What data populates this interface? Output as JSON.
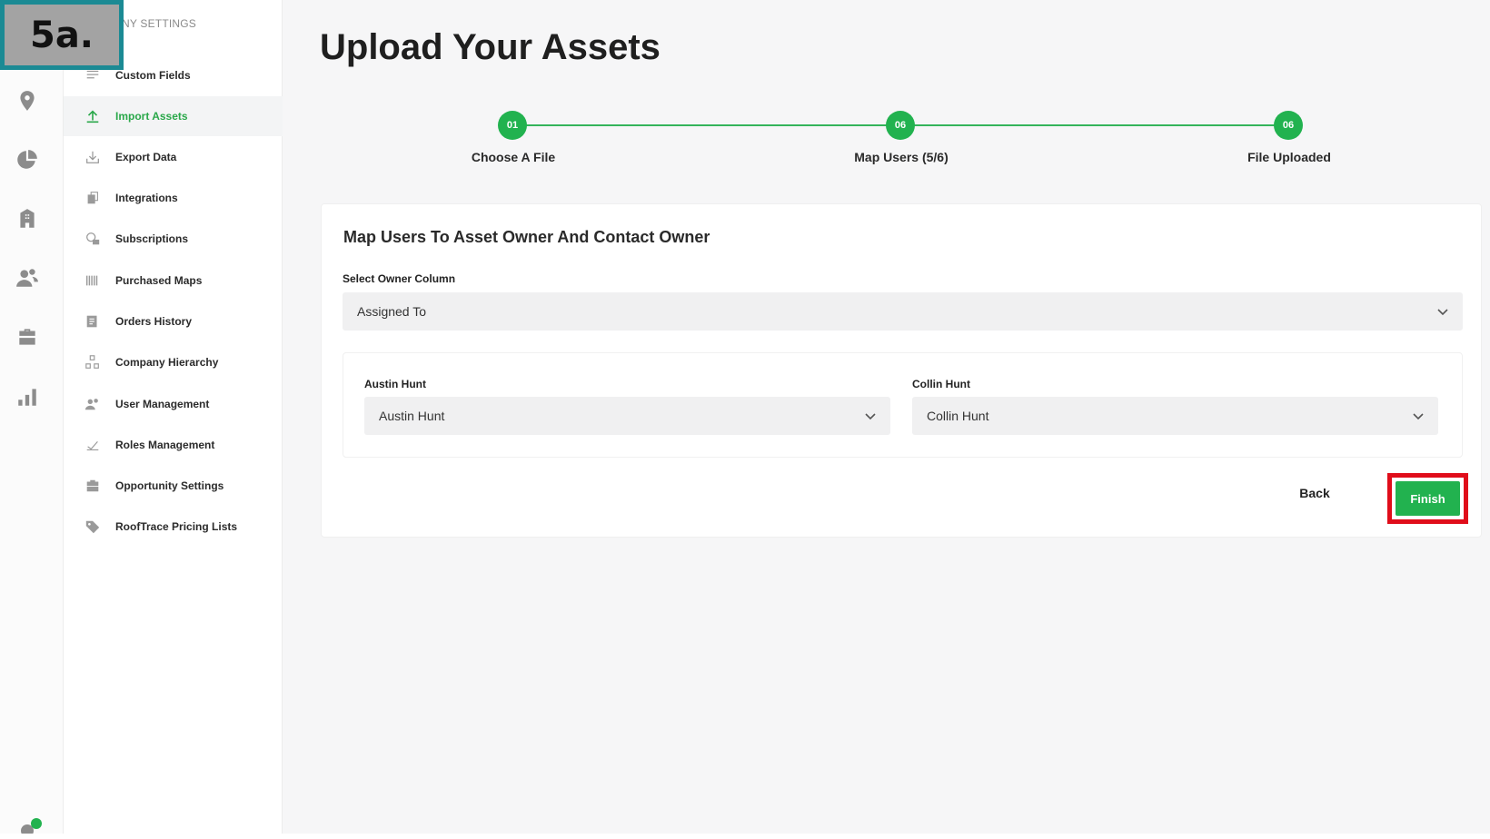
{
  "badge": {
    "text": "5a."
  },
  "settings": {
    "heading": "NY SETTINGS",
    "items": [
      {
        "label": "Custom Fields",
        "icon": "list-icon"
      },
      {
        "label": "Import Assets",
        "icon": "upload-icon",
        "active": true
      },
      {
        "label": "Export Data",
        "icon": "download-icon"
      },
      {
        "label": "Integrations",
        "icon": "integrations-icon"
      },
      {
        "label": "Subscriptions",
        "icon": "subscriptions-icon"
      },
      {
        "label": "Purchased Maps",
        "icon": "barcode-icon"
      },
      {
        "label": "Orders History",
        "icon": "orders-icon"
      },
      {
        "label": "Company Hierarchy",
        "icon": "hierarchy-icon"
      },
      {
        "label": "User Management",
        "icon": "users-icon"
      },
      {
        "label": "Roles Management",
        "icon": "roles-icon"
      },
      {
        "label": "Opportunity Settings",
        "icon": "briefcase-icon"
      },
      {
        "label": "RoofTrace Pricing Lists",
        "icon": "tag-icon"
      }
    ]
  },
  "rail": {
    "icons": [
      "location-pin-icon",
      "pie-chart-icon",
      "building-icon",
      "contacts-icon",
      "briefcase-icon",
      "bar-chart-icon"
    ]
  },
  "page": {
    "title": "Upload Your Assets",
    "steps": [
      {
        "number": "01",
        "label": "Choose A File"
      },
      {
        "number": "06",
        "label": "Map Users (5/6)"
      },
      {
        "number": "06",
        "label": "File Uploaded"
      }
    ]
  },
  "card": {
    "title": "Map Users To Asset Owner And Contact Owner",
    "owner_column_label": "Select Owner Column",
    "owner_column_value": "Assigned To",
    "users": [
      {
        "label": "Austin Hunt",
        "value": "Austin Hunt"
      },
      {
        "label": "Collin Hunt",
        "value": "Collin Hunt"
      }
    ],
    "back_label": "Back",
    "finish_label": "Finish"
  },
  "colors": {
    "accent_green": "#22b24f",
    "highlight_red": "#e00d1a",
    "badge_teal": "#1b8a94"
  }
}
